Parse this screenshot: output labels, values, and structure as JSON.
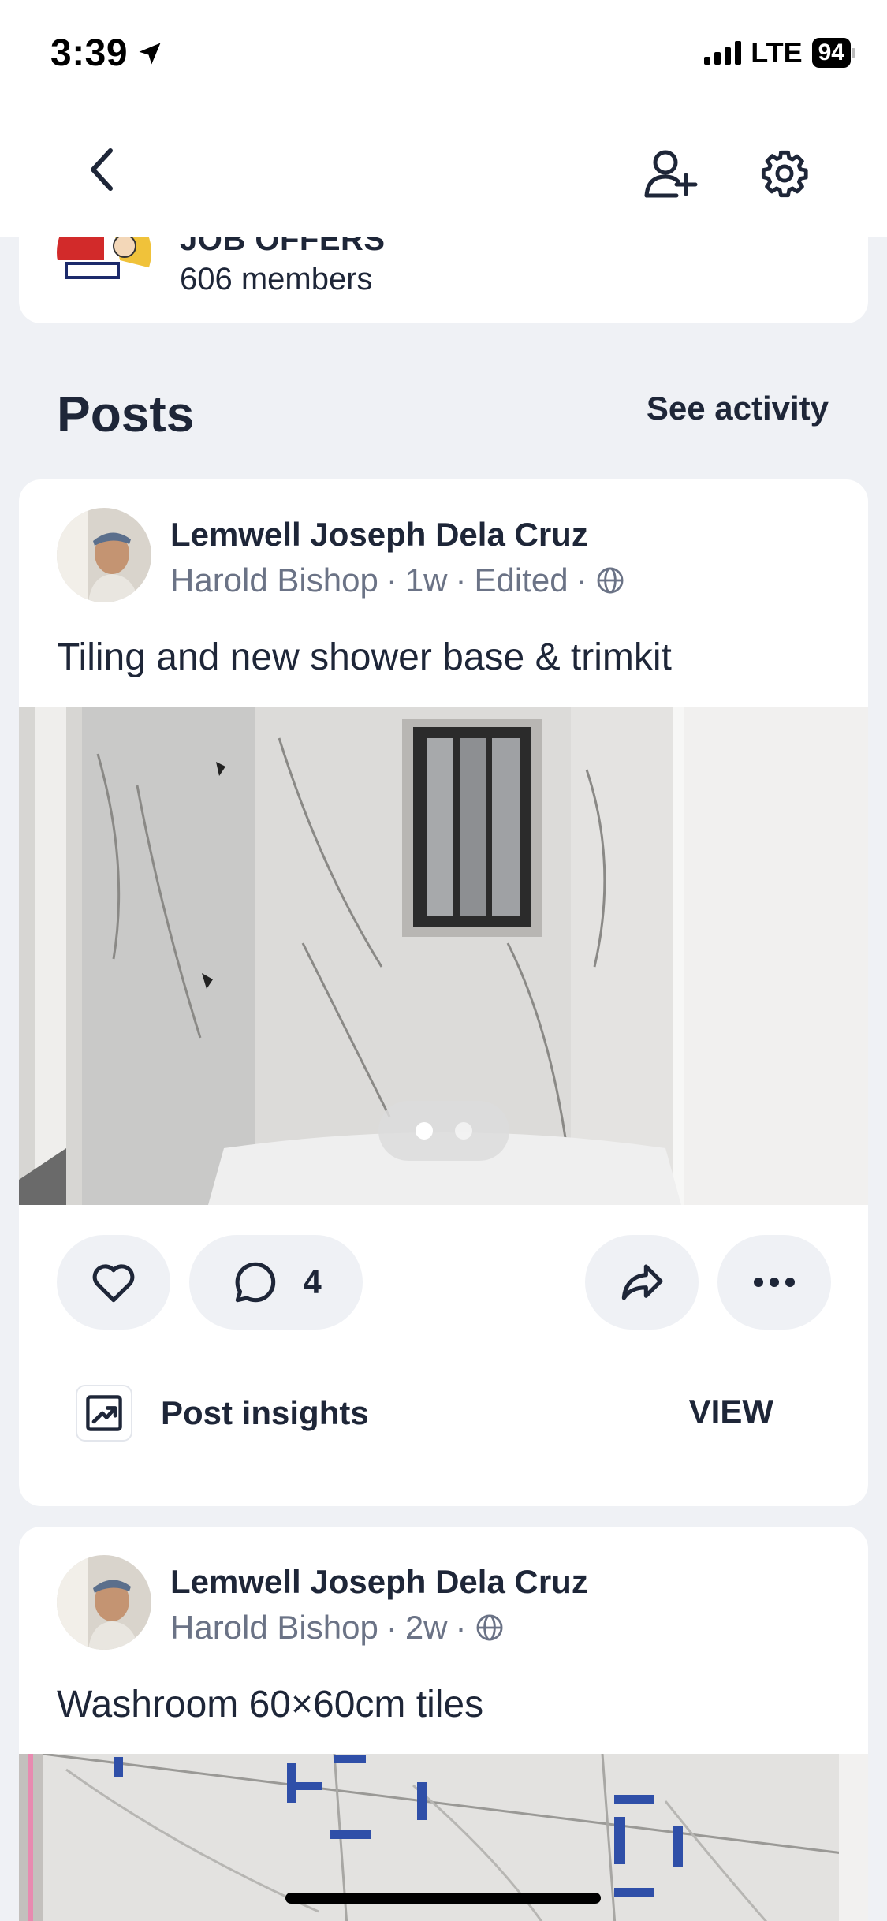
{
  "status_bar": {
    "time": "3:39",
    "network": "LTE",
    "battery": "94"
  },
  "nav": {
    "back_icon": "chevron-left-icon",
    "add_user_icon": "add-user-icon",
    "settings_icon": "gear-icon"
  },
  "group": {
    "name": "JOB OFFERS",
    "members": "606 members"
  },
  "posts_section": {
    "title": "Posts",
    "see_activity": "See activity"
  },
  "posts": [
    {
      "author": "Lemwell Joseph Dela Cruz",
      "meta_name": "Harold Bishop",
      "meta_time": "1w",
      "meta_edited": "Edited",
      "text": "Tiling and new shower base & trimkit",
      "image_dots_total": 2,
      "image_dots_active": 1,
      "comment_count": "4",
      "insights_label": "Post insights",
      "view_label": "VIEW"
    },
    {
      "author": "Lemwell Joseph Dela Cruz",
      "meta_name": "Harold Bishop",
      "meta_time": "2w",
      "text": "Washroom 60×60cm tiles"
    }
  ],
  "colors": {
    "background": "#eff1f5",
    "card": "#ffffff",
    "text_primary": "#1e2638",
    "text_secondary": "#6b7386"
  }
}
